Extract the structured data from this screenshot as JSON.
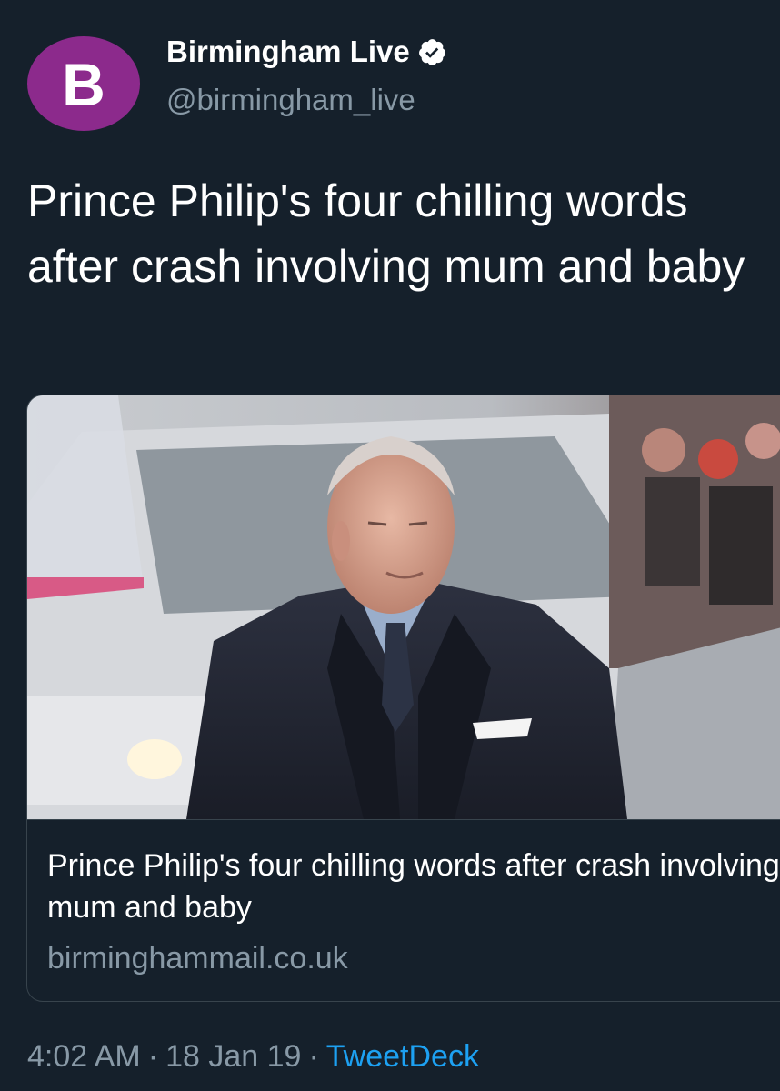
{
  "account": {
    "avatar_letter": "B",
    "avatar_color": "#8c2a8c",
    "display_name": "Birmingham Live",
    "verified_icon": "verified-badge-icon",
    "handle": "@birmingham_live"
  },
  "tweet": {
    "text": "Prince Philip's four chilling words after crash involving mum and baby"
  },
  "card": {
    "image_description": "news-photo",
    "title": "Prince Philip's four chilling words after crash involving mum and baby",
    "domain": "birminghammail.co.uk"
  },
  "meta": {
    "time": "4:02 AM",
    "separator": "·",
    "date": "18 Jan 19",
    "source": "TweetDeck"
  },
  "colors": {
    "background": "#15202b",
    "secondary_text": "#8899a6",
    "link": "#1da1f2",
    "border": "#38444d"
  }
}
